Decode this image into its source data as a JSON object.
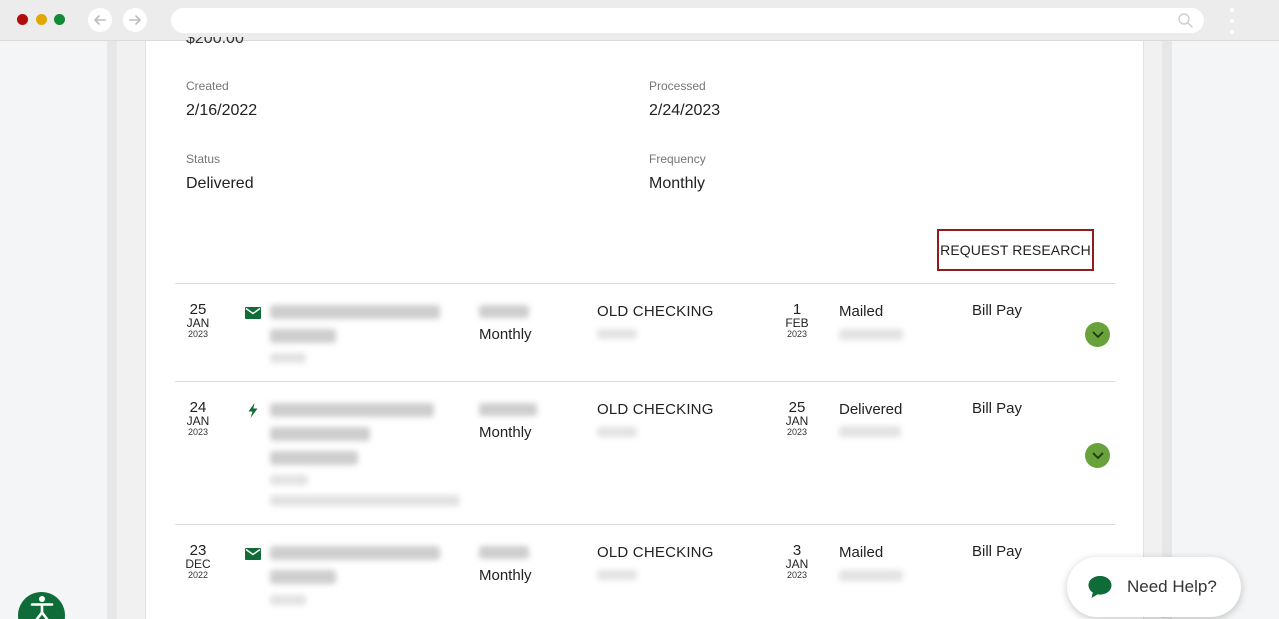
{
  "summary": {
    "clipped_amount": "$200.00",
    "created_label": "Created",
    "created_value": "2/16/2022",
    "processed_label": "Processed",
    "processed_value": "2/24/2023",
    "status_label": "Status",
    "status_value": "Delivered",
    "frequency_label": "Frequency",
    "frequency_value": "Monthly"
  },
  "actions": {
    "request_research_label": "REQUEST RESEARCH"
  },
  "rows": [
    {
      "date_day": "25",
      "date_month": "JAN",
      "date_year": "2023",
      "icon": "mail-icon",
      "frequency": "Monthly",
      "account": "OLD CHECKING",
      "deliver_day": "1",
      "deliver_month": "FEB",
      "deliver_year": "2023",
      "status": "Mailed",
      "category": "Bill Pay"
    },
    {
      "date_day": "24",
      "date_month": "JAN",
      "date_year": "2023",
      "icon": "lightning-icon",
      "frequency": "Monthly",
      "account": "OLD CHECKING",
      "deliver_day": "25",
      "deliver_month": "JAN",
      "deliver_year": "2023",
      "status": "Delivered",
      "category": "Bill Pay"
    },
    {
      "date_day": "23",
      "date_month": "DEC",
      "date_year": "2022",
      "icon": "mail-icon",
      "frequency": "Monthly",
      "account": "OLD CHECKING",
      "deliver_day": "3",
      "deliver_month": "JAN",
      "deliver_year": "2023",
      "status": "Mailed",
      "category": "Bill Pay"
    }
  ],
  "help": {
    "label": "Need Help?"
  },
  "colors": {
    "accent_green": "#0f6b38",
    "expand_green": "#69a23a",
    "highlight_red": "#8f1d1d"
  }
}
